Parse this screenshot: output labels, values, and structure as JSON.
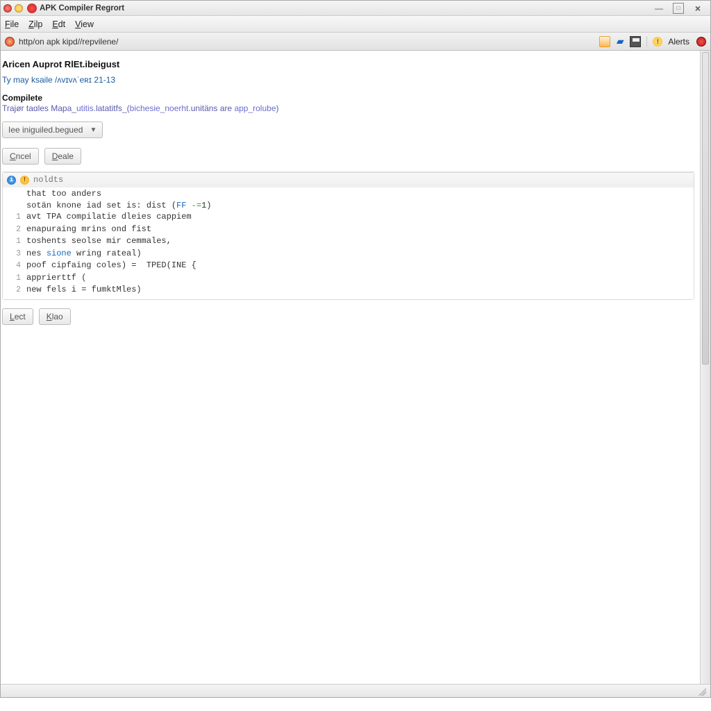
{
  "window": {
    "title": "APK Compiler Regrort"
  },
  "menubar": {
    "file_html": "<u>F</u>ile",
    "zilp_html": "<u>Z</u>ilp",
    "edit_html": "<u>E</u>dt",
    "view_html": "<u>V</u>iew"
  },
  "addressbar": {
    "url": "http/on apk kipd//repvilene/"
  },
  "toolbar": {
    "alerts_label": "Alerts"
  },
  "page": {
    "title": "Aricen Auprot RlEt.ibeigust",
    "subinfo": "Ty may ksaile /ʌvɪvʌˈeʀɪ 21-13",
    "section_header": "Compilete",
    "compile_line_html": "Trajør taɑles Mapa_<span class=\"kw\">utitis</span>.latatitfs_(<span class=\"kw\">bichesie_noerht</span>.unitäns are <span class=\"kw\">app_rolube</span>)",
    "dropdown_label": "Iee iniguiled.begued",
    "buttons": {
      "cncel_html": "<u>C</u>ncel",
      "deale_html": "<u>D</u>eale",
      "lect_html": "<u>L</u>ect",
      "klao_html": "<u>K</u>lao"
    },
    "console": {
      "header_label": "noldts",
      "rows": [
        {
          "n": "",
          "code": "that too anders"
        },
        {
          "n": "",
          "code_html": "sotän knone iad set is: dist (<span class=\"kw\">FF</span> <span class=\"op\">-=</span>1)"
        },
        {
          "n": "1",
          "code": "avt TPA compilatie dleies cappiem"
        },
        {
          "n": "2",
          "code": "enapuraing mrins ond fist"
        },
        {
          "n": "1",
          "code": "toshents seolse mir cemmales,"
        },
        {
          "n": "3",
          "code_html": "nes <span class=\"kw\">sione</span> wring rateal)"
        },
        {
          "n": "4",
          "code_html": "poof cipfaing coles) =  TPED(INE {"
        },
        {
          "n": "1",
          "code_html": "apprierttf ("
        },
        {
          "n": "2",
          "code_html": "new fels i = fumktMles)"
        }
      ]
    }
  },
  "statusbar": {
    "seg1": " ",
    "seg2": " "
  }
}
